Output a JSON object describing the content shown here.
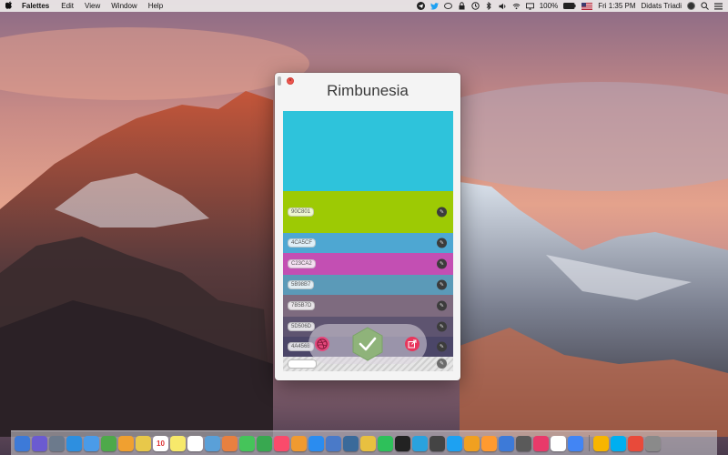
{
  "menubar": {
    "app_name": "Falettes",
    "menus": [
      "Edit",
      "View",
      "Window",
      "Help"
    ],
    "battery": "100%",
    "clock": "Fri 1:35 PM",
    "user": "Didats Triadi"
  },
  "window": {
    "title": "Rimbunesia",
    "close_glyph": "×"
  },
  "swatches": [
    {
      "hex": "",
      "color": "#2ec3db",
      "height": 88
    },
    {
      "hex": "90C801",
      "color": "#9dca04",
      "height": 46
    },
    {
      "hex": "4CA5CF",
      "color": "#4ea7d2",
      "height": 22
    },
    {
      "hex": "C23CA2",
      "color": "#c34fb3",
      "height": 24
    },
    {
      "hex": "5B98B7",
      "color": "#5b9ab8",
      "height": 22
    },
    {
      "hex": "7B5B7D",
      "color": "#7e6b7f",
      "height": 24
    },
    {
      "hex": "5D506D",
      "color": "#5e5470",
      "height": 22
    },
    {
      "hex": "4A456B",
      "color": "#4b4668",
      "height": 22
    }
  ],
  "icons": {
    "edit": "✎",
    "check": "✓",
    "share": "↗",
    "dribbble": "◎"
  },
  "colors": {
    "accent_green": "#8fb37a",
    "dribbble_pink": "#e5487c",
    "share_red": "#e8365c"
  },
  "dock": {
    "calendar_day": "10",
    "apps": [
      "finder",
      "siri",
      "launchpad",
      "safari",
      "mail",
      "evernote",
      "photos",
      "stickies",
      "calendar",
      "notes",
      "reminders",
      "preview",
      "photos-app",
      "messages",
      "facetime",
      "music",
      "books",
      "appstore",
      "xcode",
      "sqlite",
      "chrome",
      "whatsapp",
      "terminal",
      "telegram",
      "screen",
      "twitter",
      "sketch",
      "sublime",
      "finder2",
      "pixelmator",
      "hype",
      "google",
      "chrome2",
      "sketch2",
      "skype",
      "git",
      "trash"
    ]
  }
}
